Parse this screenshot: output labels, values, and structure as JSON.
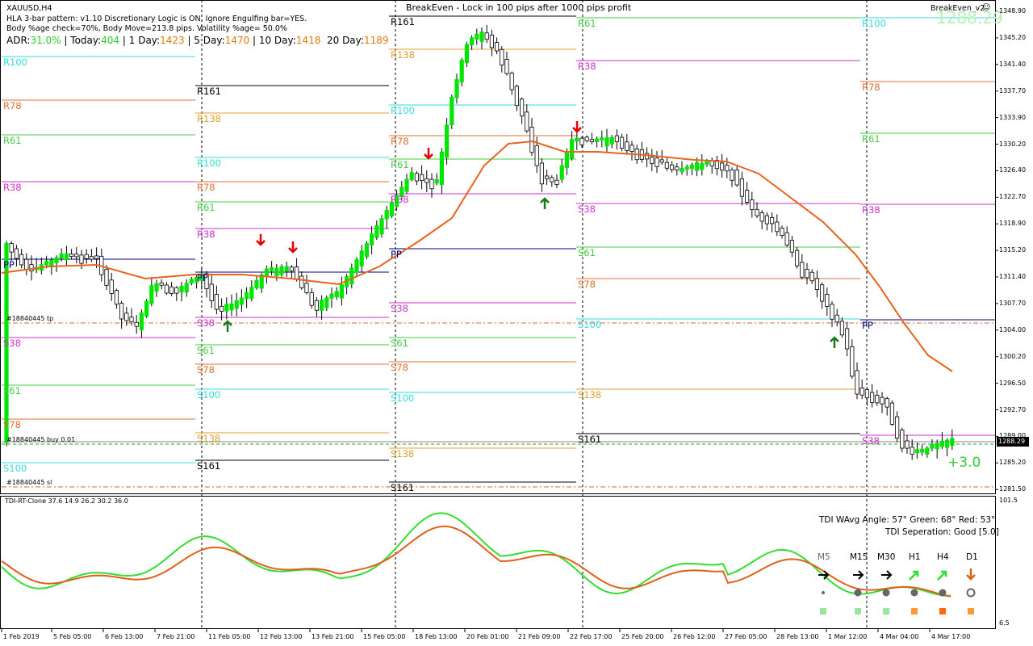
{
  "window": {
    "symbol_title": "XAUUSD,H4",
    "ea_title": "BreakEven - Lock in 100 pips after 1000 pips profit",
    "ea_name": "BreakEven_v2",
    "big_price": "1288.29",
    "profit": "+3.0"
  },
  "info_lines": [
    "HLA 3-bar pattern: v1.10 Discretionary Logic is ON. Ignore Engulfing bar=YES.",
    "Body %age check=70%, Body Move=213.8 pips. Volatility %age= 50.0%"
  ],
  "adr": {
    "adr_label": "ADR:",
    "adr_value": "31.0%",
    "today_label": "| Today:",
    "today_value": "404",
    "d1_label": "| 1 Day:",
    "d1_value": "1423",
    "d5_label": "| 5 Day:",
    "d5_value": "1470",
    "d10_label": "| 10 Day:",
    "d10_value": "1418",
    "d20_label": "20 Day:",
    "d20_value": "1189"
  },
  "pivot_labels": [
    "R161",
    "R138",
    "R100",
    "R78",
    "R61",
    "R38",
    "PP",
    "S38",
    "S61",
    "S78",
    "S100",
    "S138",
    "S161"
  ],
  "orders": {
    "tp": "#18840445 tp",
    "buy": "#18840445 buy 0.01",
    "sl": "#18840445 sl"
  },
  "price_axis": [
    "1348.90",
    "1345.20",
    "1341.40",
    "1337.70",
    "1333.90",
    "1330.20",
    "1326.40",
    "1322.70",
    "1318.90",
    "1315.20",
    "1311.40",
    "1307.70",
    "1304.00",
    "1300.20",
    "1296.50",
    "1292.70",
    "1289.00",
    "1285.20",
    "1281.50"
  ],
  "current_price": "1288.29",
  "indicator": {
    "name": "TDI-RT-Clone 37.6 14.9 26.2 30.2 36.0",
    "top": "101.5",
    "bottom": "6.5",
    "angle_text": "TDI WAvg Angle: 57°  Green: 68°  Red: 53°",
    "sep_text": "TDI Seperation: Good [5.0]",
    "timeframes": [
      "M5",
      "M15",
      "M30",
      "H1",
      "H4",
      "D1"
    ]
  },
  "date_axis": [
    "1 Feb 2019",
    "5 Feb 05:00",
    "6 Feb 13:00",
    "7 Feb 21:00",
    "11 Feb 05:00",
    "12 Feb 13:00",
    "13 Feb 21:00",
    "15 Feb 05:00",
    "18 Feb 13:00",
    "20 Feb 01:00",
    "21 Feb 09:00",
    "22 Feb 17:00",
    "25 Feb 20:00",
    "26 Feb 12:00",
    "27 Feb 05:00",
    "28 Feb 13:00",
    "1 Mar 12:00",
    "4 Mar 04:00",
    "4 Mar 17:00"
  ],
  "colors": {
    "bull": "#00e600",
    "bear": "#ffffff",
    "ma": "#e8641e",
    "tdi_green": "#33dd33",
    "tdi_red": "#e0601a",
    "r161": "#000000",
    "r138": "#e0a030",
    "r100": "#33dddd",
    "r78": "#e07030",
    "r61": "#44cc44",
    "r38": "#cc33cc",
    "pp": "#000080"
  }
}
